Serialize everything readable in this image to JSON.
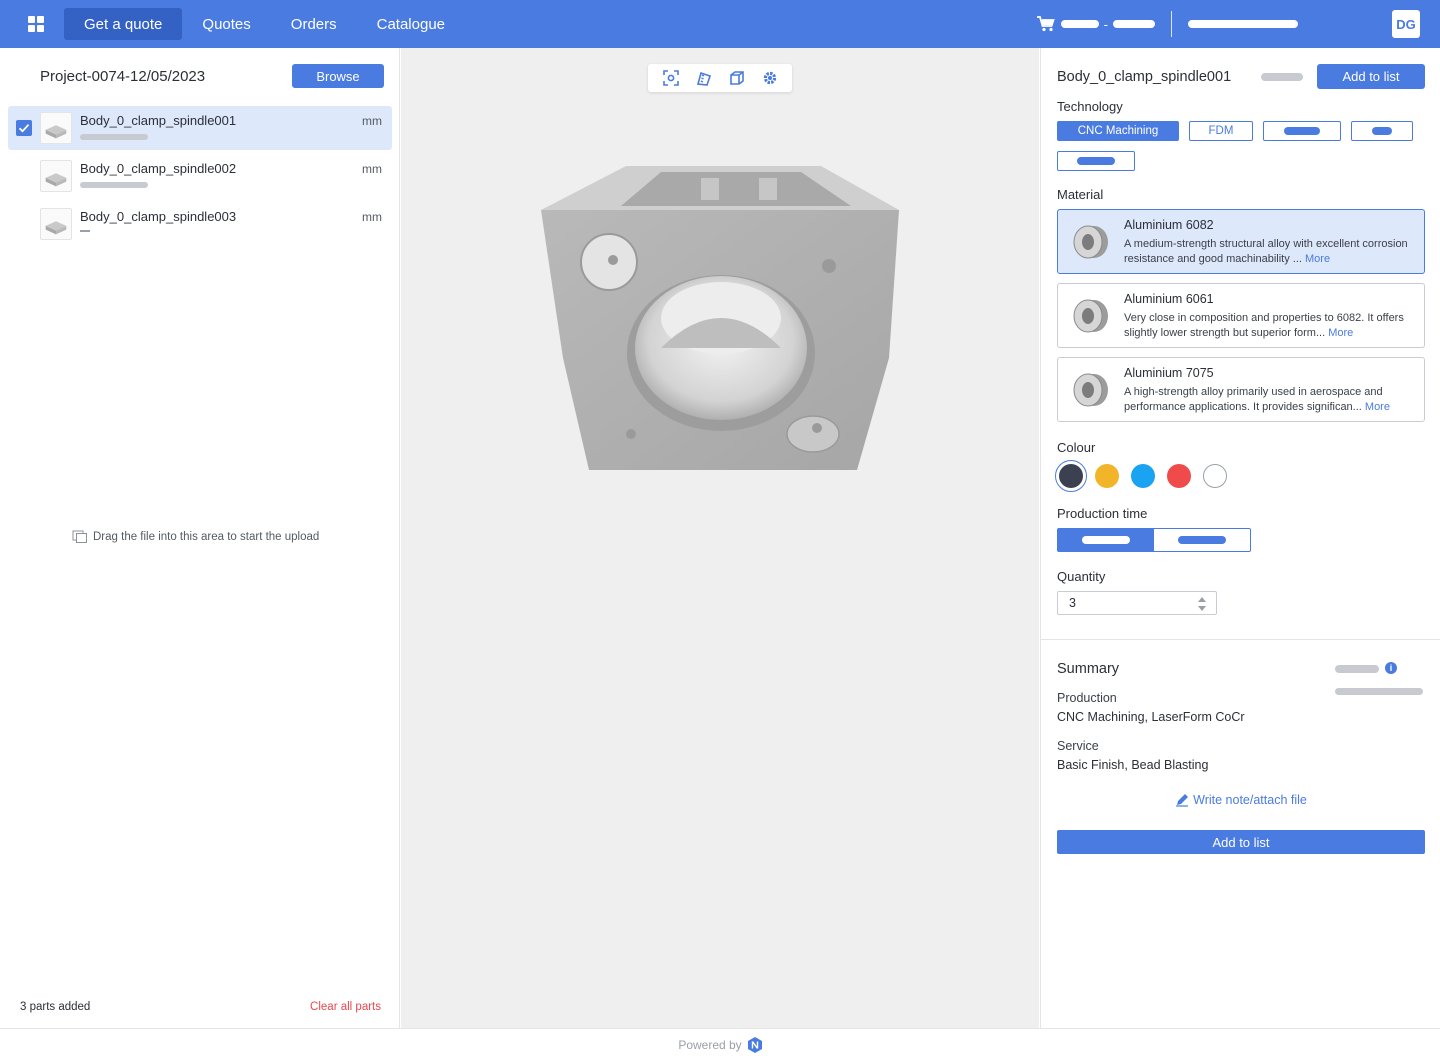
{
  "nav": {
    "tabs": [
      {
        "label": "Get a quote"
      },
      {
        "label": "Quotes"
      },
      {
        "label": "Orders"
      },
      {
        "label": "Catalogue"
      }
    ],
    "cart_separator": "-",
    "user_initials": "DG"
  },
  "left_panel": {
    "project_title": "Project-0074-12/05/2023",
    "browse_label": "Browse",
    "parts": [
      {
        "name": "Body_0_clamp_spindle001",
        "unit": "mm"
      },
      {
        "name": "Body_0_clamp_spindle002",
        "unit": "mm"
      },
      {
        "name": "Body_0_clamp_spindle003",
        "unit": "mm"
      }
    ],
    "drop_hint": "Drag the file into this area to start the upload",
    "parts_count": "3 parts added",
    "clear_label": "Clear all parts"
  },
  "right_panel": {
    "part_title": "Body_0_clamp_spindle001",
    "add_to_list_label": "Add to list",
    "technology_label": "Technology",
    "technologies": [
      {
        "label": "CNC Machining"
      },
      {
        "label": "FDM"
      }
    ],
    "material_label": "Material",
    "materials": [
      {
        "name": "Aluminium 6082",
        "desc": "A medium-strength structural alloy with excellent corrosion resistance and good machinability ...",
        "more": "More"
      },
      {
        "name": "Aluminium 6061",
        "desc": "Very close in composition and properties to 6082. It offers slightly lower strength but superior form...",
        "more": "More"
      },
      {
        "name": "Aluminium 7075",
        "desc": "A high-strength alloy primarily used in aerospace and performance applications. It provides significan...",
        "more": "More"
      }
    ],
    "colour_label": "Colour",
    "colours": [
      "#3b4150",
      "#f2b52a",
      "#1aa3f0",
      "#ef4b4b",
      "#ffffff"
    ],
    "production_time_label": "Production time",
    "quantity_label": "Quantity",
    "quantity_value": "3",
    "summary": {
      "title": "Summary",
      "production_label": "Production",
      "production_value": "CNC Machining, LaserForm CoCr",
      "service_label": "Service",
      "service_value": "Basic Finish, Bead Blasting",
      "note_label": "Write note/attach file",
      "add_label": "Add to list"
    }
  },
  "footer": {
    "powered_by": "Powered by"
  },
  "colors": {
    "accent": "#4a7be0",
    "accent_dark": "#3461c4",
    "danger": "#e5484d"
  }
}
